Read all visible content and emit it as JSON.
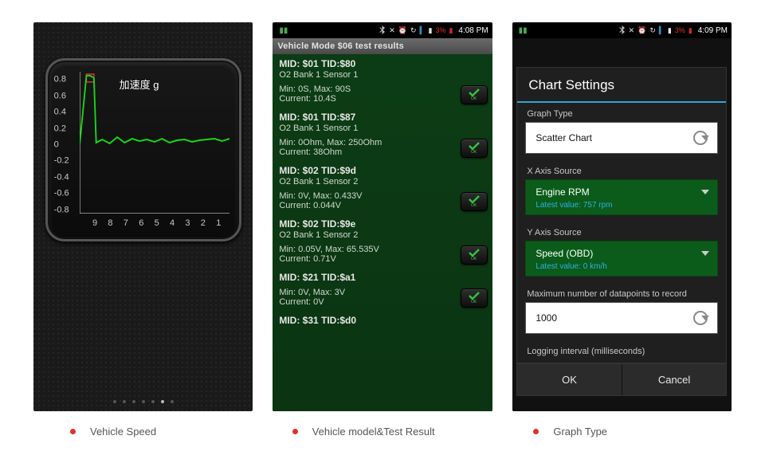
{
  "captions": [
    "Vehicle Speed",
    "Vehicle model&Test Result",
    "Graph Type"
  ],
  "status1": {},
  "status2": {
    "pct": "3%",
    "time": "4:08 PM"
  },
  "status3": {
    "pct": "3%",
    "time": "4:09 PM"
  },
  "chart_data": {
    "type": "line",
    "title": "加速度 g",
    "xlabel": "",
    "ylabel": "",
    "ylim": [
      -0.9,
      0.9
    ],
    "xlim": [
      0,
      10
    ],
    "y_ticks": [
      "0.8",
      "0.6",
      "0.4",
      "0.2",
      "0",
      "-0.2",
      "-0.4",
      "-0.6",
      "-0.8"
    ],
    "x_ticks": [
      "9",
      "8",
      "7",
      "6",
      "5",
      "4",
      "3",
      "2",
      "1"
    ],
    "x": [
      10.0,
      9.5,
      9.3,
      9.2,
      9.0,
      8.5,
      8.0,
      7.5,
      7.0,
      6.5,
      6.0,
      5.5,
      5.0,
      4.5,
      4.0,
      3.5,
      3.0,
      2.5,
      2.0,
      1.5,
      1.0,
      0.5,
      0.0
    ],
    "y": [
      -0.02,
      0.9,
      0.9,
      0.9,
      0.0,
      0.05,
      0.0,
      0.1,
      0.02,
      0.06,
      0.03,
      0.04,
      0.02,
      0.05,
      0.01,
      0.03,
      0.04,
      0.02,
      0.03,
      0.04,
      0.05,
      0.03,
      0.05
    ]
  },
  "pager": {
    "count": 7,
    "active": 5
  },
  "p2": {
    "title": "Vehicle Mode $06 test results",
    "tests": [
      {
        "mid": "MID: $01 TID:$80",
        "sub": "O2 Bank 1 Sensor 1",
        "mm": "Min: 0S, Max: 90S",
        "cur": "Current: 10.4S",
        "ok": true
      },
      {
        "mid": "MID: $01 TID:$87",
        "sub": "O2 Bank 1 Sensor 1",
        "mm": "Min: 0Ohm, Max: 250Ohm",
        "cur": "Current: 38Ohm",
        "ok": true
      },
      {
        "mid": "MID: $02 TID:$9d",
        "sub": "O2 Bank 1 Sensor 2",
        "mm": "Min: 0V, Max: 0.433V",
        "cur": "Current: 0.044V",
        "ok": true
      },
      {
        "mid": "MID: $02 TID:$9e",
        "sub": "O2 Bank 1 Sensor 2",
        "mm": "Min: 0.05V, Max: 65.535V",
        "cur": "Current: 0.71V",
        "ok": true
      },
      {
        "mid": "MID: $21 TID:$a1",
        "sub": "",
        "mm": "Min: 0V, Max: 3V",
        "cur": "Current: 0V",
        "ok": true
      },
      {
        "mid": "MID: $31 TID:$d0",
        "sub": "",
        "mm": "",
        "cur": "",
        "ok": false
      }
    ]
  },
  "p3": {
    "title": "Chart Settings",
    "graph_type_label": "Graph Type",
    "graph_type_value": "Scatter Chart",
    "x_label": "X Axis Source",
    "x_value": "Engine RPM",
    "x_latest": "Latest value: 757 rpm",
    "y_label": "Y Axis Source",
    "y_value": "Speed (OBD)",
    "y_latest": "Latest value: 0 km/h",
    "max_label": "Maximum number of datapoints to record",
    "max_value": "1000",
    "interval_label": "Logging interval (milliseconds)",
    "ok": "OK",
    "cancel": "Cancel"
  }
}
